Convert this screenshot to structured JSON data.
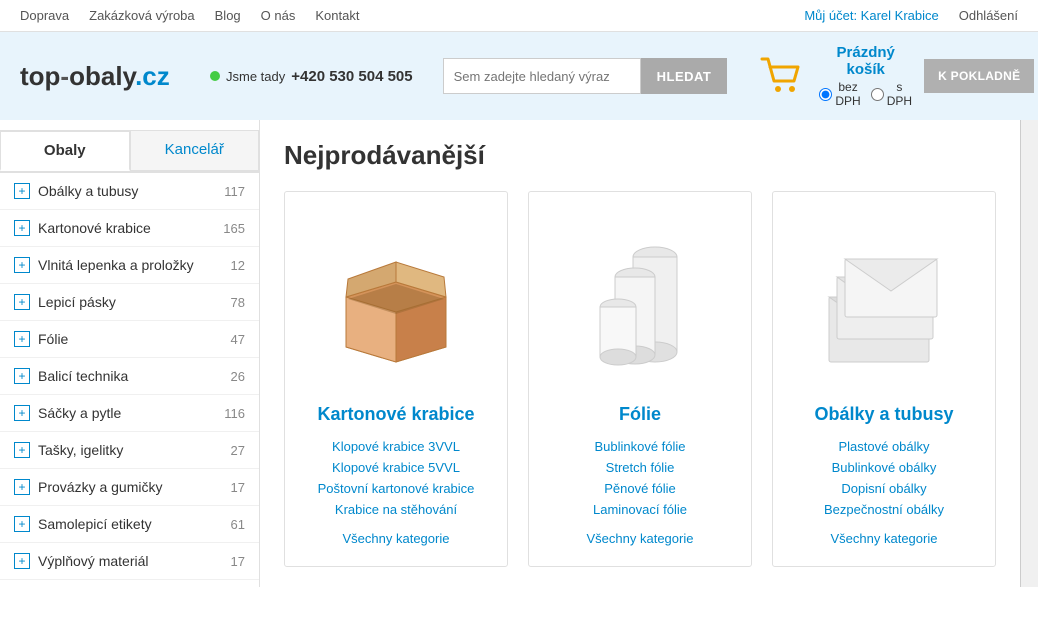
{
  "topnav": {
    "left": [
      {
        "label": "Doprava",
        "href": "#"
      },
      {
        "label": "Zakázková výroba",
        "href": "#"
      },
      {
        "label": "Blog",
        "href": "#"
      },
      {
        "label": "O nás",
        "href": "#"
      },
      {
        "label": "Kontakt",
        "href": "#"
      }
    ],
    "right": {
      "my_account_label": "Můj účet: Karel Krabice",
      "logout_label": "Odhlášení"
    }
  },
  "header": {
    "logo": "top-obaly.cz",
    "contact": {
      "status": "Jsme tady",
      "phone": "+420 530 504 505"
    },
    "search": {
      "placeholder": "Sem zadejte hledaný výraz",
      "button": "HLEDAT"
    },
    "cart": {
      "title": "Prázdný košík",
      "option_without_tax": "bez DPH",
      "option_with_tax": "s DPH",
      "checkout_button": "K POKLADNĚ"
    }
  },
  "sidebar": {
    "tabs": [
      {
        "label": "Obaly",
        "active": true
      },
      {
        "label": "Kancelář",
        "active": false
      }
    ],
    "items": [
      {
        "label": "Obálky a tubusy",
        "count": "117"
      },
      {
        "label": "Kartonové krabice",
        "count": "165"
      },
      {
        "label": "Vlnitá lepenka a proložky",
        "count": "12"
      },
      {
        "label": "Lepicí pásky",
        "count": "78"
      },
      {
        "label": "Fólie",
        "count": "47"
      },
      {
        "label": "Balicí technika",
        "count": "26"
      },
      {
        "label": "Sáčky a pytle",
        "count": "116"
      },
      {
        "label": "Tašky, igelitky",
        "count": "27"
      },
      {
        "label": "Provázky a gumičky",
        "count": "17"
      },
      {
        "label": "Samolepicí etikety",
        "count": "61"
      },
      {
        "label": "Výplňový materiál",
        "count": "17"
      }
    ]
  },
  "content": {
    "page_title": "Nejprodávanější",
    "cards": [
      {
        "title": "Kartonové krabice",
        "links": [
          "Klopové krabice 3VVL",
          "Klopové krabice 5VVL",
          "Poštovní kartonové krabice",
          "Krabice na stěhování"
        ],
        "all_link": "Všechny kategorie"
      },
      {
        "title": "Fólie",
        "links": [
          "Bublinkové fólie",
          "Stretch fólie",
          "Pěnové fólie",
          "Laminovací fólie"
        ],
        "all_link": "Všechny kategorie"
      },
      {
        "title": "Obálky a tubusy",
        "links": [
          "Plastové obálky",
          "Bublinkové obálky",
          "Dopisní obálky",
          "Bezpečnostní obálky"
        ],
        "all_link": "Všechny kategorie"
      }
    ]
  }
}
